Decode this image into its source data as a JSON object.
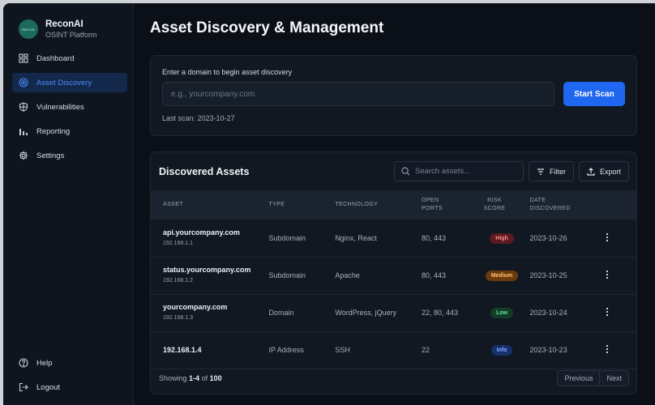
{
  "brand": {
    "logo_text": "RECON",
    "name": "ReconAI",
    "subtitle": "OSINT Platform"
  },
  "sidebar": {
    "items": [
      {
        "label": "Dashboard",
        "icon": "dashboard-icon",
        "active": false
      },
      {
        "label": "Asset Discovery",
        "icon": "target-icon",
        "active": true
      },
      {
        "label": "Vulnerabilities",
        "icon": "shield-icon",
        "active": false
      },
      {
        "label": "Reporting",
        "icon": "bar-chart-icon",
        "active": false
      },
      {
        "label": "Settings",
        "icon": "gear-icon",
        "active": false
      }
    ],
    "bottom": [
      {
        "label": "Help",
        "icon": "help-icon"
      },
      {
        "label": "Logout",
        "icon": "logout-icon"
      }
    ]
  },
  "page": {
    "title": "Asset Discovery & Management"
  },
  "scan": {
    "label": "Enter a domain to begin asset discovery",
    "placeholder": "e.g., yourcompany.com",
    "value": "",
    "button": "Start Scan",
    "last_scan": "Last scan: 2023-10-27"
  },
  "assets": {
    "title": "Discovered Assets",
    "search_placeholder": "Search assets...",
    "filter_label": "Filter",
    "export_label": "Export",
    "columns": [
      "ASSET",
      "TYPE",
      "TECHNOLOGY",
      "OPEN PORTS",
      "RISK SCORE",
      "DATE DISCOVERED"
    ],
    "rows": [
      {
        "asset": "api.yourcompany.com",
        "ip": "192.168.1.1",
        "type": "Subdomain",
        "technology": "Nginx, React",
        "ports": "80, 443",
        "risk": "High",
        "date": "2023-10-26"
      },
      {
        "asset": "status.yourcompany.com",
        "ip": "192.168.1.2",
        "type": "Subdomain",
        "technology": "Apache",
        "ports": "80, 443",
        "risk": "Medium",
        "date": "2023-10-25"
      },
      {
        "asset": "yourcompany.com",
        "ip": "192.168.1.3",
        "type": "Domain",
        "technology": "WordPress, jQuery",
        "ports": "22, 80, 443",
        "risk": "Low",
        "date": "2023-10-24"
      },
      {
        "asset": "192.168.1.4",
        "ip": "",
        "type": "IP Address",
        "technology": "SSH",
        "ports": "22",
        "risk": "Info",
        "date": "2023-10-23"
      }
    ],
    "pager": {
      "prefix": "Showing",
      "range": "1-4",
      "of": "of",
      "total": "100",
      "prev": "Previous",
      "next": "Next"
    }
  },
  "colors": {
    "accent": "#1f66f0",
    "risk": {
      "High": {
        "bg": "#5a1a1f",
        "fg": "#ff8b8b"
      },
      "Medium": {
        "bg": "#6b3a0c",
        "fg": "#ffc070"
      },
      "Low": {
        "bg": "#123d26",
        "fg": "#5fe39a"
      },
      "Info": {
        "bg": "#17306b",
        "fg": "#86a9ff"
      }
    }
  }
}
